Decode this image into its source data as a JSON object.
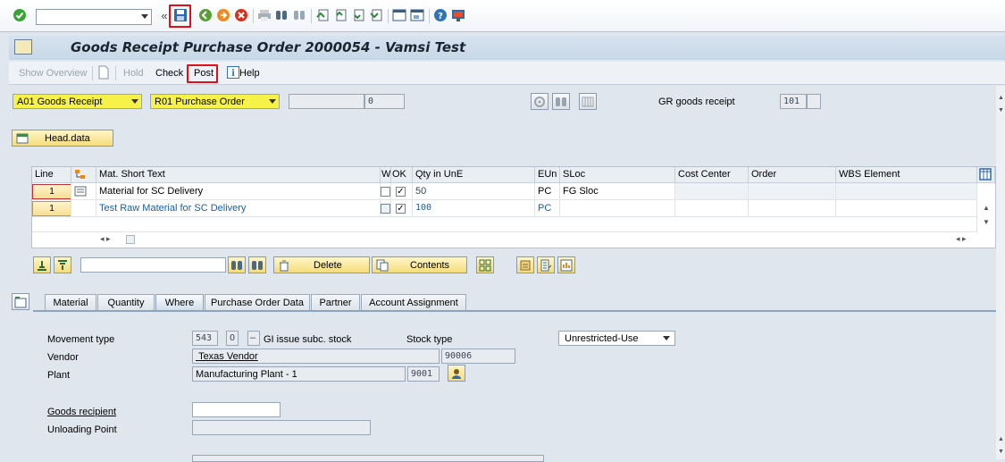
{
  "toolbar": {
    "command_field_value": "",
    "icons": [
      "enter-icon",
      "back-double-chevron-icon",
      "save-icon",
      "back-icon",
      "exit-icon",
      "cancel-icon",
      "print-icon",
      "find-icon",
      "find-next-icon",
      "first-page-icon",
      "previous-page-icon",
      "next-page-icon",
      "last-page-icon",
      "create-session-icon",
      "shortcut-icon",
      "help-icon",
      "customize-layout-icon"
    ]
  },
  "title": "Goods Receipt Purchase Order 2000054 - Vamsi Test",
  "app_toolbar": {
    "show_overview": "Show Overview",
    "hold": "Hold",
    "check": "Check",
    "post": "Post",
    "help": "Help"
  },
  "header": {
    "action": "A01 Goods Receipt",
    "reference": "R01 Purchase Order",
    "ref_doc_number": "",
    "ref_doc_item": "0",
    "gr_label": "GR goods receipt",
    "movement_code": "101",
    "head_data_button": "Head.data"
  },
  "table": {
    "columns": [
      "Line",
      "",
      "Mat. Short Text",
      "W",
      "OK",
      "Qty in UnE",
      "EUn",
      "SLoc",
      "Cost Center",
      "Order",
      "WBS Element"
    ],
    "rows": [
      {
        "line": "1",
        "text": "Material for SC Delivery",
        "w": "",
        "ok": "✓",
        "qty": "50",
        "eun": "PC",
        "sloc": "FG Sloc",
        "cost_center": "",
        "order": "",
        "wbs": ""
      },
      {
        "line": "1",
        "text": "Test  Raw Material for SC Delivery",
        "w": "",
        "ok": "✓",
        "qty": "100",
        "eun": "PC",
        "sloc": "",
        "cost_center": "",
        "order": "",
        "wbs": ""
      }
    ]
  },
  "item_toolbar": {
    "search_value": "",
    "delete": "Delete",
    "contents": "Contents"
  },
  "tabs": [
    "Material",
    "Quantity",
    "Where",
    "Purchase Order Data",
    "Partner",
    "Account Assignment"
  ],
  "active_tab": "Where",
  "where": {
    "movement_type_label": "Movement type",
    "movement_type": "543",
    "special_stock": "O",
    "dash": "–",
    "movement_desc": "GI issue subc. stock",
    "stock_type_label": "Stock type",
    "stock_type": "Unrestricted-Use",
    "vendor_label": "Vendor",
    "vendor_name": "Texas Vendor",
    "vendor_number": "90006",
    "plant_label": "Plant",
    "plant_name": "Manufacturing Plant - 1",
    "plant_number": "9001",
    "goods_recipient_label": "Goods recipient",
    "goods_recipient": "",
    "unloading_point_label": "Unloading Point",
    "unloading_point": ""
  },
  "colors": {
    "highlight": "#f7f24a",
    "annotation_red": "#e0101a",
    "background": "#dfe6ee"
  }
}
